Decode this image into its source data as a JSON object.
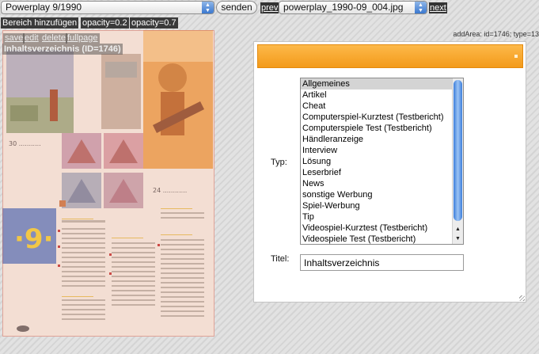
{
  "toolbar": {
    "issue_select": "Powerplay 9/1990",
    "send_label": "senden",
    "prev_label": "prev",
    "page_select": "powerplay_1990-09_004.jpg",
    "next_label": "next"
  },
  "tools": {
    "add_area_label": "Bereich hinzufügen",
    "opacity_low_label": "opacity=0.2",
    "opacity_high_label": "opacity=0.7",
    "save_label": "save",
    "edit_label": "edit",
    "delete_label": "delete",
    "fullpage_label": "fullpage"
  },
  "info": {
    "add_area_text": "addArea: id=1746; type=13"
  },
  "scan": {
    "area_label": "Inhaltsverzeichnis (ID=1746)",
    "colors": {
      "overlay": "#ff9682",
      "orange_art": "#e8a040",
      "blue_block": "#1a60b8"
    }
  },
  "form": {
    "typ_label": "Typ:",
    "titel_label": "Titel:",
    "title_value": "Inhaltsverzeichnis",
    "selected_index": 0,
    "types": [
      "Allgemeines",
      "Artikel",
      "Cheat",
      "Computerspiel-Kurztest (Testbericht)",
      "Computerspiele Test (Testbericht)",
      "Händleranzeige",
      "Interview",
      "Lösung",
      "Leserbrief",
      "News",
      "sonstige Werbung",
      "Spiel-Werbung",
      "Tip",
      "Videospiel-Kurztest (Testbericht)",
      "Videospiele Test (Testbericht)"
    ]
  },
  "colors": {
    "header_orange": "#f5a42e",
    "scroll_blue": "#3d7fdc"
  }
}
